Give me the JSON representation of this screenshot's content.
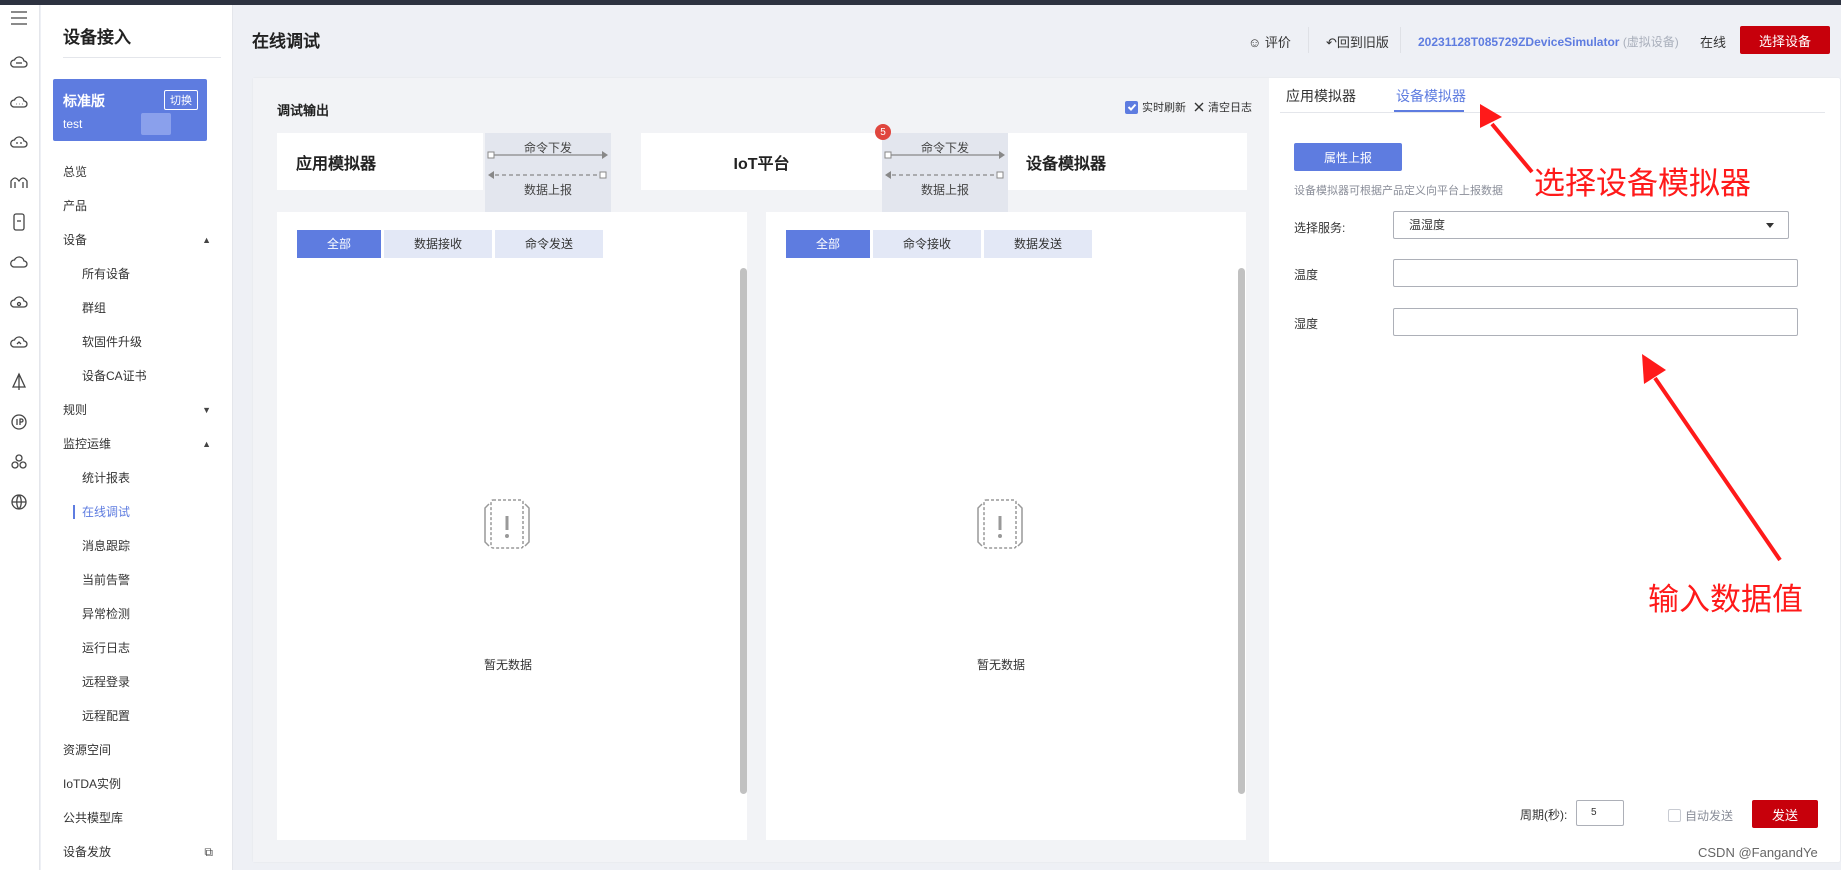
{
  "sidebar": {
    "title": "设备接入",
    "edition": {
      "name": "标准版",
      "switch_label": "切换",
      "workspace": "test"
    },
    "items": [
      {
        "label": "总览"
      },
      {
        "label": "产品"
      },
      {
        "label": "设备"
      },
      {
        "label": "所有设备"
      },
      {
        "label": "群组"
      },
      {
        "label": "软固件升级"
      },
      {
        "label": "设备CA证书"
      },
      {
        "label": "规则"
      },
      {
        "label": "监控运维"
      },
      {
        "label": "统计报表"
      },
      {
        "label": "在线调试"
      },
      {
        "label": "消息跟踪"
      },
      {
        "label": "当前告警"
      },
      {
        "label": "异常检测"
      },
      {
        "label": "运行日志"
      },
      {
        "label": "远程登录"
      },
      {
        "label": "远程配置"
      },
      {
        "label": "资源空间"
      },
      {
        "label": "IoTDA实例"
      },
      {
        "label": "公共模型库"
      },
      {
        "label": "设备发放"
      }
    ]
  },
  "header": {
    "title": "在线调试",
    "rate_label": "评价",
    "old_version_label": "回到旧版",
    "device_id": "20231128T085729ZDeviceSimulator",
    "device_virtual": "(虚拟设备)",
    "status": "在线",
    "select_device_label": "选择设备"
  },
  "debug": {
    "title": "调试输出",
    "realtime_label": "实时刷新",
    "clear_label": "清空日志",
    "app_sim_label": "应用模拟器",
    "platform_label": "IoT平台",
    "device_sim_label": "设备模拟器",
    "cmd_down_label": "命令下发",
    "data_up_label": "数据上报",
    "badge_count": "5",
    "left_tabs": [
      "全部",
      "数据接收",
      "命令发送"
    ],
    "right_tabs": [
      "全部",
      "命令接收",
      "数据发送"
    ],
    "empty_text": "暂无数据"
  },
  "simulator": {
    "tabs": [
      "应用模拟器",
      "设备模拟器"
    ],
    "report_label": "属性上报",
    "hint": "设备模拟器可根据产品定义向平台上报数据",
    "service_label": "选择服务:",
    "service_value": "温湿度",
    "temp_label": "温度",
    "temp_value": "",
    "humidity_label": "湿度",
    "humidity_value": "",
    "period_label": "周期(秒):",
    "period_value": "5",
    "auto_send_label": "自动发送",
    "send_label": "发送"
  },
  "annotations": {
    "select_device_sim": "选择设备模拟器",
    "input_value": "输入数据值"
  },
  "watermark": "CSDN @FangandYe",
  "colors": {
    "brand_blue": "#5e7ce0",
    "danger_red": "#c7000b",
    "annotation_red": "#ff1a1a"
  }
}
